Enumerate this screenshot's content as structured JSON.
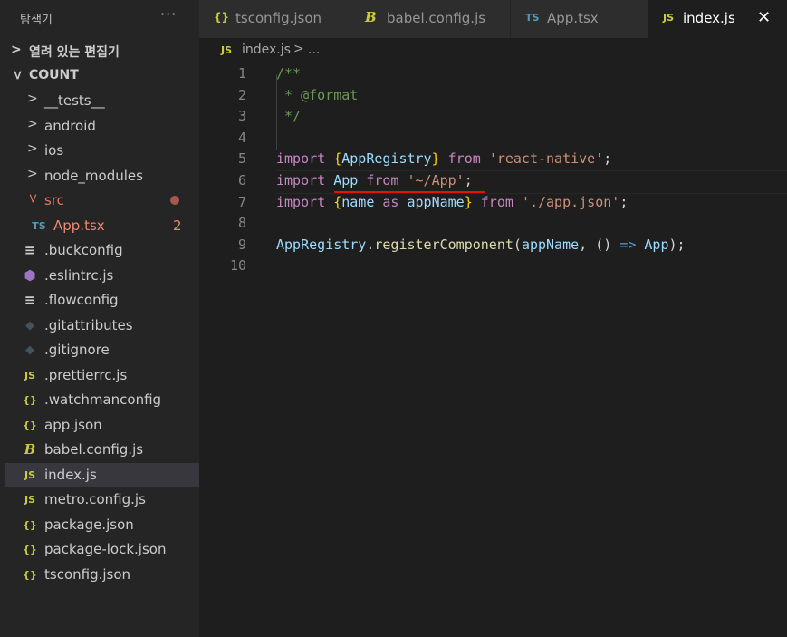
{
  "sidebar": {
    "title": "탐색기",
    "more_label": "···",
    "open_editors_label": "열려 있는 편집기",
    "project_label": "COUNT",
    "items": [
      {
        "name": "__tests__",
        "kind": "folder",
        "icon": "chevron-right"
      },
      {
        "name": "android",
        "kind": "folder",
        "icon": "chevron-right"
      },
      {
        "name": "ios",
        "kind": "folder",
        "icon": "chevron-right"
      },
      {
        "name": "node_modules",
        "kind": "folder",
        "icon": "chevron-right"
      },
      {
        "name": "src",
        "kind": "folder-open",
        "icon": "chevron-down",
        "status": "modified-dot"
      },
      {
        "name": "App.tsx",
        "kind": "file",
        "icon_text": "TS",
        "badge": "2"
      },
      {
        "name": ".buckconfig",
        "kind": "file",
        "icon_text": "≡"
      },
      {
        "name": ".eslintrc.js",
        "kind": "file",
        "icon_text": "⬢"
      },
      {
        "name": ".flowconfig",
        "kind": "file",
        "icon_text": "≡"
      },
      {
        "name": ".gitattributes",
        "kind": "file",
        "icon_text": "◆"
      },
      {
        "name": ".gitignore",
        "kind": "file",
        "icon_text": "◆"
      },
      {
        "name": ".prettierrc.js",
        "kind": "file",
        "icon_text": "JS"
      },
      {
        "name": ".watchmanconfig",
        "kind": "file",
        "icon_text": "{}"
      },
      {
        "name": "app.json",
        "kind": "file",
        "icon_text": "{}"
      },
      {
        "name": "babel.config.js",
        "kind": "file",
        "icon_text": "B"
      },
      {
        "name": "index.js",
        "kind": "file",
        "icon_text": "JS",
        "selected": true
      },
      {
        "name": "metro.config.js",
        "kind": "file",
        "icon_text": "JS"
      },
      {
        "name": "package.json",
        "kind": "file",
        "icon_text": "{}"
      },
      {
        "name": "package-lock.json",
        "kind": "file",
        "icon_text": "{}"
      },
      {
        "name": "tsconfig.json",
        "kind": "file",
        "icon_text": "{}"
      }
    ]
  },
  "tabs": [
    {
      "label": "tsconfig.json",
      "icon_text": "{}"
    },
    {
      "label": "babel.config.js",
      "icon_text": "B"
    },
    {
      "label": "App.tsx",
      "icon_text": "TS"
    },
    {
      "label": "index.js",
      "icon_text": "JS",
      "active": true,
      "close": "✕"
    }
  ],
  "breadcrumb": {
    "icon_text": "JS",
    "file": "index.js",
    "separator": ">",
    "more": "..."
  },
  "editor": {
    "line_numbers": [
      "1",
      "2",
      "3",
      "4",
      "5",
      "6",
      "7",
      "8",
      "9",
      "10"
    ],
    "code": {
      "l1": "/**",
      "l2": " * @format",
      "l3": " */",
      "l5_import": "import ",
      "l5_open": "{",
      "l5_name": "AppRegistry",
      "l5_close": "}",
      "l5_from": " from ",
      "l5_str": "'react-native'",
      "l5_semi": ";",
      "l6_import": "import ",
      "l6_name": "App",
      "l6_from": " from ",
      "l6_str": "'~/App'",
      "l6_semi": ";",
      "l7_import": "import ",
      "l7_open": "{",
      "l7_name": "name",
      "l7_as": " as ",
      "l7_alias": "appName",
      "l7_close": "}",
      "l7_from": " from ",
      "l7_str": "'./app.json'",
      "l7_semi": ";",
      "l9_obj": "AppRegistry",
      "l9_dot": ".",
      "l9_fn": "registerComponent",
      "l9_open": "(",
      "l9_arg": "appName",
      "l9_comma": ", () ",
      "l9_arrow": "=>",
      "l9_space": " ",
      "l9_ret": "App",
      "l9_close": ");"
    }
  },
  "colors": {
    "folder_src": "#e07a5f",
    "badge_red": "#f48771",
    "ts_blue": "#519aba",
    "js_yellow": "#cbcb41",
    "squiggle": "#e51400"
  }
}
